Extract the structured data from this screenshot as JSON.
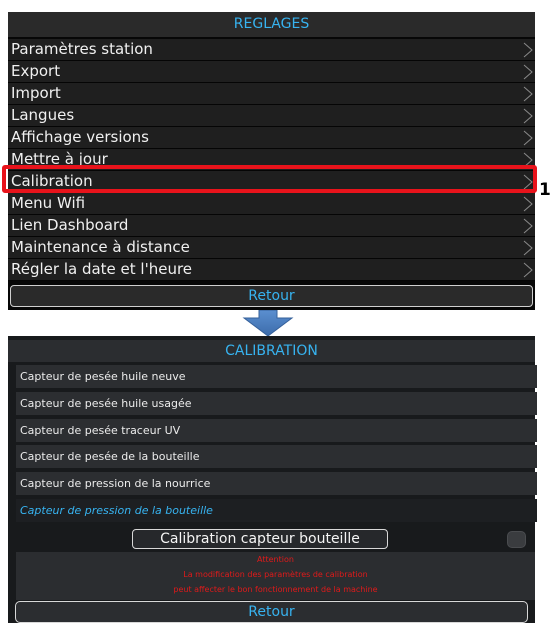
{
  "reglages": {
    "title": "REGLAGES",
    "items": [
      "Paramètres station",
      "Export",
      "Import",
      "Langues",
      "Affichage versions",
      "Mettre à jour",
      "Calibration",
      "Menu Wifi",
      "Lien Dashboard",
      "Maintenance à distance",
      "Régler la date et l'heure"
    ],
    "back_label": "Retour",
    "highlighted_item": "Calibration"
  },
  "callout_number": "1",
  "calibration": {
    "title": "CALIBRATION",
    "items": [
      "Capteur de pesée huile neuve",
      "Capteur de pesée huile usagée",
      "Capteur de pesée traceur UV",
      "Capteur de pesée de la  bouteille",
      "Capteur de pression de la nourrice",
      "Capteur de pression de la bouteille"
    ],
    "selected_item": "Capteur de pression de la bouteille",
    "action_label": "Calibration capteur bouteille",
    "warning": [
      "Attention",
      "La modification des paramètres de calibration",
      "peut affecter le bon fonctionnement de la machine"
    ],
    "back_label": "Retour"
  },
  "colors": {
    "accent": "#37b3f0",
    "highlight": "#e8131b",
    "warning": "#e01a1a",
    "arrow": "#4a7fc0"
  },
  "icons": {
    "chevron": "chevron-right-icon",
    "arrow": "down-arrow-icon"
  }
}
